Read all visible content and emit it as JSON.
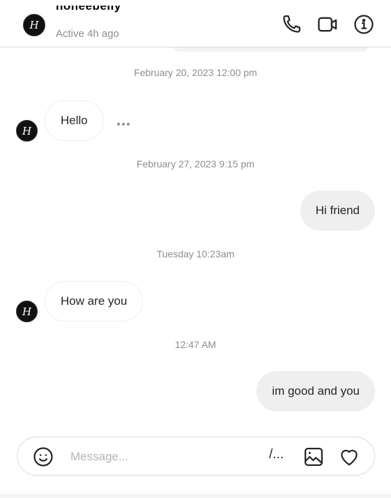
{
  "header": {
    "contact_name": "honeebelly",
    "status": "Active 4h ago",
    "avatar_letter": "H",
    "icons": [
      "phone-icon",
      "video-call-icon",
      "info-icon"
    ]
  },
  "messages": [
    {
      "type": "timestamp",
      "text": "February 20, 2023 12:00 pm"
    },
    {
      "type": "incoming",
      "text": "Hello",
      "avatar_letter": "H",
      "has_more": true
    },
    {
      "type": "timestamp",
      "text": "February 27, 2023 9:15 pm"
    },
    {
      "type": "outgoing",
      "text": "Hi friend"
    },
    {
      "type": "timestamp",
      "text": "Tuesday 10:23am"
    },
    {
      "type": "incoming",
      "text": "How are you",
      "avatar_letter": "H"
    },
    {
      "type": "timestamp",
      "text": "12:47 AM"
    },
    {
      "type": "outgoing",
      "text": "im good and you"
    }
  ],
  "composer": {
    "placeholder": "Message...",
    "value": "",
    "command_label": "/..."
  }
}
